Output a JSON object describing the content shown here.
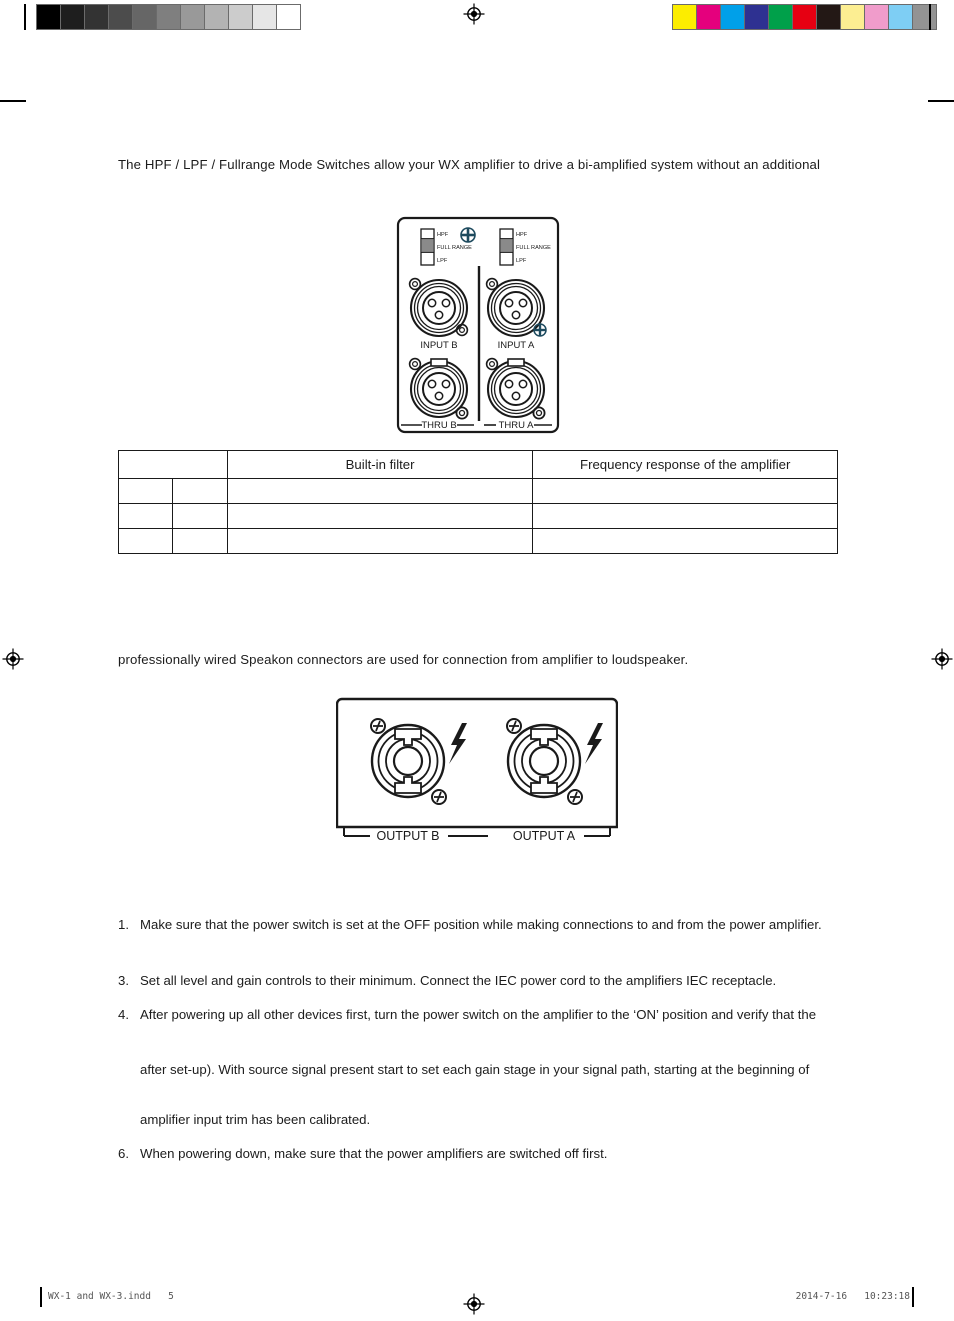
{
  "page": {
    "paragraph_intro": "The HPF / LPF / Fullrange Mode Switches allow your WX amplifier to drive a bi-amplified system without an additional",
    "paragraph_speakon": "professionally wired Speakon connectors are used for connection from amplifier to loudspeaker."
  },
  "spec_table": {
    "columns": [
      "",
      "",
      "Built-in filter",
      "Frequency response of the amplifier"
    ],
    "rows": [
      [
        "",
        "",
        "",
        ""
      ],
      [
        "",
        "",
        "",
        ""
      ],
      [
        "",
        "",
        "",
        ""
      ]
    ]
  },
  "input_panel": {
    "switch_labels": [
      "HPF",
      "FULL RANGE",
      "LPF"
    ],
    "connector_labels": [
      "INPUT B",
      "INPUT A",
      "THRU B",
      "THRU A"
    ]
  },
  "output_panel": {
    "connector_labels": [
      "OUTPUT B",
      "OUTPUT A"
    ]
  },
  "steps": [
    {
      "number": "1.",
      "text": "Make sure that the power switch is set at the OFF position while making connections to and from the power amplifier."
    },
    {
      "number": "3.",
      "text": "Set all level and gain controls to their minimum. Connect the IEC power cord to the amplifiers IEC receptacle."
    },
    {
      "number": "4.",
      "text": "After powering up all other devices first, turn the power switch on the amplifier to the ‘ON’ position and verify that the"
    },
    {
      "number": "",
      "text": "after set-up). With source signal present start to set each gain stage in your signal path, starting at the beginning of"
    },
    {
      "number": "",
      "text": "amplifier input trim has been calibrated."
    },
    {
      "number": "6.",
      "text": "When powering down, make sure that the power amplifiers are switched off first."
    }
  ],
  "footer": {
    "file_name": "WX-1 and WX-3.indd   5",
    "timestamp": "2014-7-16   10:23:18"
  },
  "calibration": {
    "gray_swatches": [
      "#000000",
      "#1e1e1e",
      "#333333",
      "#4c4c4c",
      "#666666",
      "#7f7f7f",
      "#999999",
      "#b3b3b3",
      "#cccccc",
      "#e6e6e6",
      "#ffffff"
    ],
    "color_swatches": [
      "#fced00",
      "#e5007d",
      "#00a0e9",
      "#2e3191",
      "#00a04a",
      "#e60012",
      "#231815",
      "#fcee92",
      "#f09ccb",
      "#7ecef4",
      "#939393"
    ]
  }
}
